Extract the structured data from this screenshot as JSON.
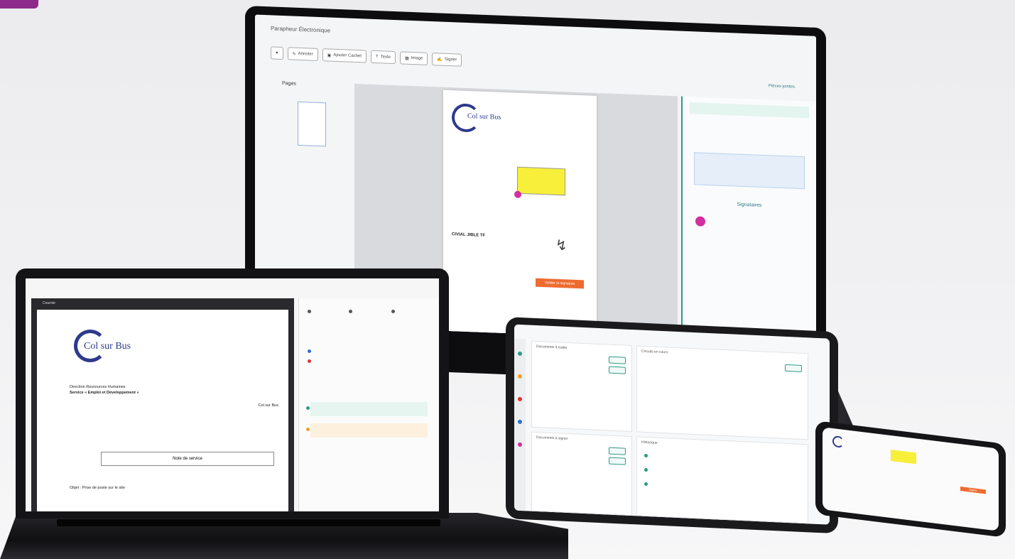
{
  "monitor": {
    "app_title": "Parapheur Électronique",
    "toolbar": [
      {
        "icon": "pen-icon",
        "label": "Annoter"
      },
      {
        "icon": "stamp-icon",
        "label": "Ajouter Cachet"
      },
      {
        "icon": "text-icon",
        "label": "Texte"
      },
      {
        "icon": "image-icon",
        "label": "Image"
      },
      {
        "icon": "sign-icon",
        "label": "Signer"
      }
    ],
    "thumbnails_label": "Pages",
    "document": {
      "logo_text": "Col sur Bus",
      "name_line": "CIVIAL JIBLE TF",
      "action_label": "Valider la signature"
    },
    "side_panel": {
      "heading": "Pièces jointes",
      "signers_heading": "Signataires"
    },
    "colors": {
      "accent": "#2c9b86",
      "badge": "#d1309e",
      "action": "#ee6b2f",
      "note": "#f7ef3a"
    }
  },
  "laptop": {
    "viewer_title": "Courrier",
    "logo_text": "Col sur Bus",
    "header_lines": [
      "Direction Ressources Humaines",
      "Service « Emploi et Développement »"
    ],
    "recipient": "Col sur Bus",
    "box_label": "Note de service",
    "subject_line": "Objet : Prise de poste sur le site"
  },
  "tablet": {
    "cards": [
      "Documents à traiter",
      "Circuits en cours",
      "Documents à signer",
      "Historique"
    ]
  },
  "phone": {
    "action_label": "Signer"
  }
}
